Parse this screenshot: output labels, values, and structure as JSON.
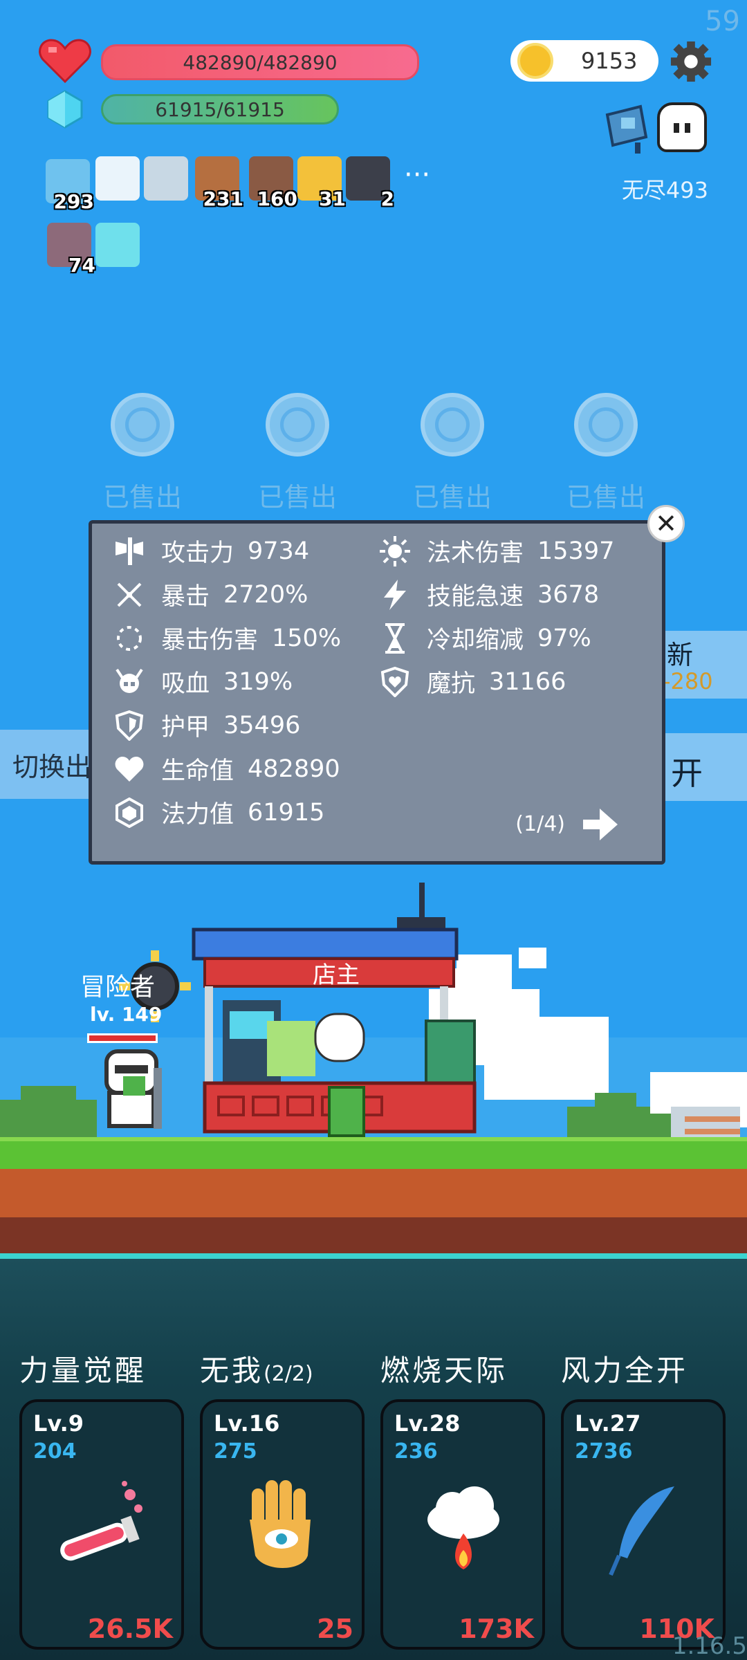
{
  "status": {
    "fps": "59",
    "version": "1.16.5"
  },
  "player": {
    "hp_text": "482890/482890",
    "mp_text": "61915/61915",
    "hp_fraction": 1.0,
    "mp_fraction": 1.0
  },
  "currency": {
    "coins": "9153"
  },
  "mode": {
    "endless_label": "无尽493"
  },
  "buffs": [
    {
      "icon": "star-card-icon",
      "count": "293"
    },
    {
      "icon": "wing-icon",
      "count": ""
    },
    {
      "icon": "sword-icon",
      "count": ""
    },
    {
      "icon": "round-shield-icon",
      "count": "231"
    },
    {
      "icon": "helmet-icon",
      "count": "160"
    },
    {
      "icon": "crown-icon",
      "count": "31"
    },
    {
      "icon": "mortar-icon",
      "count": "2"
    },
    {
      "icon": "striped-card-icon",
      "count": "74"
    },
    {
      "icon": "glow-card-icon",
      "count": ""
    }
  ],
  "more_dots": "···",
  "shop_slots": [
    {
      "label": "已售出"
    },
    {
      "label": "已售出"
    },
    {
      "label": "已售出"
    },
    {
      "label": "已售出"
    }
  ],
  "side": {
    "switch_label": "切换出",
    "refresh_label": "新",
    "refresh_cost": "-280",
    "open_label": "开"
  },
  "stats_panel": {
    "left": [
      {
        "icon": "axe-icon",
        "label": "攻击力",
        "value": "9734"
      },
      {
        "icon": "crit-icon",
        "label": "暴击",
        "value": "2720%"
      },
      {
        "icon": "crit-damage-icon",
        "label": "暴击伤害",
        "value": "150%"
      },
      {
        "icon": "skull-icon",
        "label": "吸血",
        "value": "319%"
      },
      {
        "icon": "armor-shield-icon",
        "label": "护甲",
        "value": "35496"
      },
      {
        "icon": "heart-icon",
        "label": "生命值",
        "value": "482890"
      },
      {
        "icon": "mana-gem-icon",
        "label": "法力值",
        "value": "61915"
      }
    ],
    "right": [
      {
        "icon": "sun-icon",
        "label": "法术伤害",
        "value": "15397"
      },
      {
        "icon": "lightning-icon",
        "label": "技能急速",
        "value": "3678"
      },
      {
        "icon": "hourglass-icon",
        "label": "冷却缩减",
        "value": "97%"
      },
      {
        "icon": "magic-shield-icon",
        "label": "魔抗",
        "value": "31166"
      }
    ],
    "page": "(1/4)"
  },
  "scene": {
    "shop_label": "店主",
    "adventurer_name": "冒险者",
    "adventurer_level": "lv. 149"
  },
  "skills": [
    {
      "name": "力量觉醒",
      "sub": "",
      "level": "Lv.9",
      "value": "204",
      "cost": "26.5K",
      "icon": "potion-icon"
    },
    {
      "name": "无我",
      "sub": "(2/2)",
      "level": "Lv.16",
      "value": "275",
      "cost": "25",
      "icon": "eye-hand-icon"
    },
    {
      "name": "燃烧天际",
      "sub": "",
      "level": "Lv.28",
      "value": "236",
      "cost": "173K",
      "icon": "fire-cloud-icon"
    },
    {
      "name": "风力全开",
      "sub": "",
      "level": "Lv.27",
      "value": "2736",
      "cost": "110K",
      "icon": "feather-icon"
    }
  ]
}
